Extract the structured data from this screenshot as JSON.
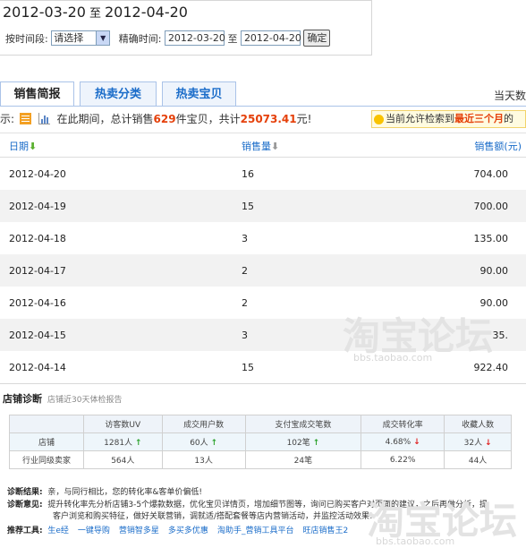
{
  "range": {
    "start": "2012-03-20",
    "sep": "至",
    "end": "2012-04-20"
  },
  "filter": {
    "period_label": "按时间段:",
    "period_value": "请选择",
    "exact_label": "精确时间:",
    "exact_start": "2012-03-20",
    "exact_sep": "至",
    "exact_end": "2012-04-20",
    "confirm": "确定"
  },
  "tabs": [
    {
      "label": "销售简报"
    },
    {
      "label": "热卖分类"
    },
    {
      "label": "热卖宝贝"
    }
  ],
  "today_text": "当天数",
  "summary": {
    "prefix": "示:",
    "t1": "在此期间，总计销售",
    "count": "629",
    "t2": "件宝贝，共计",
    "amount": "25073.41",
    "t3": "元!"
  },
  "note": {
    "t1": "当前允许检索到",
    "highlight": "最近三个月",
    "t2": "的"
  },
  "table": {
    "headers": [
      "日期",
      "销售量",
      "销售额(元)"
    ],
    "rows": [
      [
        "2012-04-20",
        "16",
        "704.00"
      ],
      [
        "2012-04-19",
        "15",
        "700.00"
      ],
      [
        "2012-04-18",
        "3",
        "135.00"
      ],
      [
        "2012-04-17",
        "2",
        "90.00"
      ],
      [
        "2012-04-16",
        "2",
        "90.00"
      ],
      [
        "2012-04-15",
        "3",
        "35."
      ],
      [
        "2012-04-14",
        "15",
        "922.40"
      ]
    ]
  },
  "diagnosis": {
    "title": "店铺诊断",
    "subtitle": "店铺近30天体检报告",
    "headers": [
      "",
      "访客数UV",
      "成交用户数",
      "支付宝成交笔数",
      "成交转化率",
      "收藏人数"
    ],
    "shop_label": "店铺",
    "shop": [
      "1281人",
      "60人",
      "102笔",
      "4.68%",
      "32人"
    ],
    "shop_trend": [
      "up",
      "up",
      "up",
      "down",
      "down"
    ],
    "industry_label": "行业同级卖家",
    "industry": [
      "564人",
      "13人",
      "24笔",
      "6.22%",
      "44人"
    ],
    "result_label": "诊断结果:",
    "result_text": "亲，与同行相比，您的转化率&客单价偏低!",
    "advice_label": "诊断意见:",
    "advice_line1": "提升转化率先分析店铺3-5个爆款数据，优化宝贝详情页，增加细节图等，询问已购买客户对页面的建议，之后再做分析，提",
    "advice_line2": "客户浏览和购买特征，做好关联营销，调就适/搭配套餐等店内营销活动，并监控活动效果!",
    "tools_label": "推荐工具:",
    "tools": [
      "生e经",
      "一键导购",
      "营销智多星",
      "多买多优惠",
      "淘助手_营销工具平台",
      "旺店销售王2"
    ]
  },
  "watermark": {
    "text": "淘宝论坛",
    "sub": "bbs.taobao.com"
  }
}
